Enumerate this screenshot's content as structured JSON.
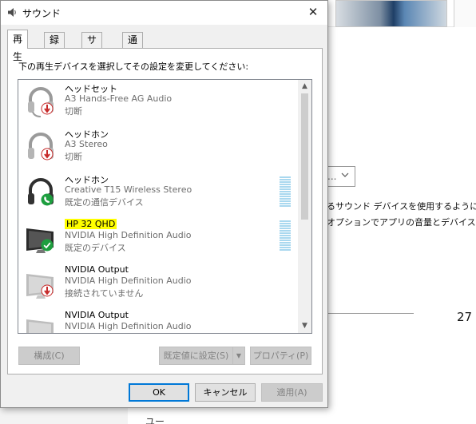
{
  "background": {
    "select_value": "...",
    "text_line1": "るサウンド デバイスを使用するように訂",
    "text_line2": "オプションでアプリの音量とデバイスを",
    "number": "27",
    "bottom_text": "ユー"
  },
  "dialog": {
    "title": "サウンド",
    "close": "✕",
    "tabs": [
      {
        "label": "再生"
      },
      {
        "label": "録音"
      },
      {
        "label": "サウンド"
      },
      {
        "label": "通信"
      }
    ],
    "instruction": "下の再生デバイスを選択してその設定を変更してください:",
    "devices": [
      {
        "name": "ヘッドセット",
        "description": "A3 Hands-Free AG Audio",
        "status": "切断",
        "icon": "headset-icon",
        "badge": "disconnected-badge"
      },
      {
        "name": "ヘッドホン",
        "description": "A3 Stereo",
        "status": "切断",
        "icon": "headphones-icon",
        "badge": "disconnected-badge"
      },
      {
        "name": "ヘッドホン",
        "description": "Creative T15 Wireless Stereo",
        "status": "既定の通信デバイス",
        "icon": "headphones-icon",
        "badge": "phone-badge"
      },
      {
        "name": "HP 32 QHD",
        "description": "NVIDIA High Definition Audio",
        "status": "既定のデバイス",
        "icon": "monitor-icon",
        "badge": "check-badge"
      },
      {
        "name": "NVIDIA Output",
        "description": "NVIDIA High Definition Audio",
        "status": "接続されていません",
        "icon": "monitor-icon",
        "badge": "disconnected-badge"
      },
      {
        "name": "NVIDIA Output",
        "description": "NVIDIA High Definition Audio",
        "status": "",
        "icon": "monitor-icon",
        "badge": ""
      }
    ],
    "buttons": {
      "configure": "構成(C)",
      "set_default": "既定値に設定(S)",
      "properties": "プロパティ(P)",
      "ok": "OK",
      "cancel": "キャンセル",
      "apply": "適用(A)"
    }
  },
  "colors": {
    "highlight": "#ffff00",
    "selection_border": "#0078d7",
    "meter": "#a9d8ef",
    "badge_red": "#d32f2f",
    "badge_green": "#1e9e3f"
  }
}
